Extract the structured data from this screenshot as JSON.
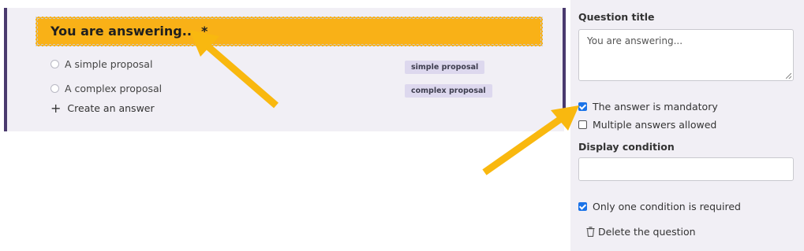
{
  "question": {
    "title": "You are answering...",
    "required_marker": "*",
    "answers": [
      {
        "label": "A simple proposal",
        "tag": "simple proposal"
      },
      {
        "label": "A complex proposal",
        "tag": "complex proposal"
      }
    ],
    "create_answer_label": "Create an answer"
  },
  "panel": {
    "question_title_label": "Question title",
    "question_title_value": "You are answering...",
    "mandatory_label": "The answer is mandatory",
    "mandatory_checked": true,
    "multiple_label": "Multiple answers allowed",
    "multiple_checked": false,
    "display_condition_label": "Display condition",
    "display_condition_value": "",
    "one_condition_label": "Only one condition is required",
    "one_condition_checked": true,
    "delete_label": "Delete the question"
  },
  "colors": {
    "accent": "#f9b117",
    "border_purple": "#4a3a6e",
    "panel_bg": "#f1eff5",
    "tag_bg": "#ddd8ee",
    "checkbox_blue": "#1a73e8"
  },
  "icons": [
    "plus-icon",
    "trash-icon",
    "arrow-annotation"
  ]
}
